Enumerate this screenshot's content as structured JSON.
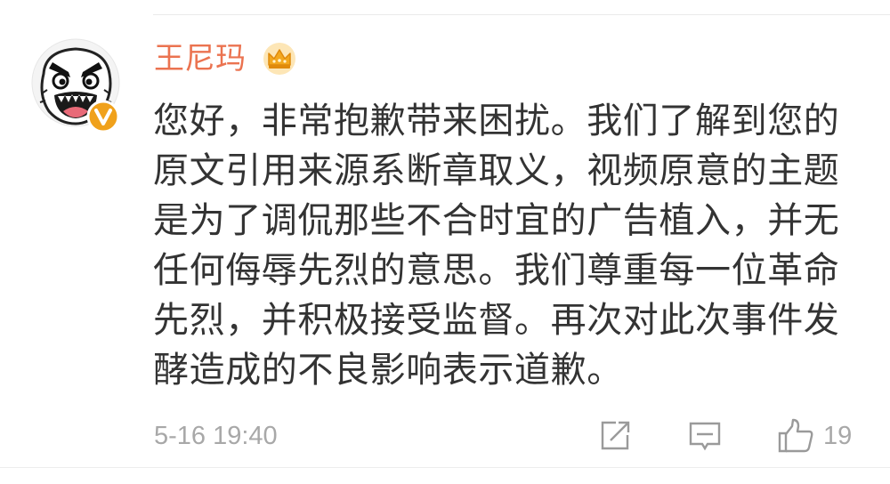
{
  "comment": {
    "username": "王尼玛",
    "username_color": "#eb7350",
    "badges": {
      "member_icon": "crown-icon",
      "verified_icon": "verified-v-icon"
    },
    "avatar_icon": "rage-face-avatar",
    "body_lines": [
      "您好，非常抱歉带来困扰。我们了解到您的",
      "原文引用来源系断章取义，视频原意的主题",
      "是为了调侃那些不合时宜的广告植入，并无",
      "任何侮辱先烈的意思。我们尊重每一位革命",
      "先烈，并积极接受监督。再次对此次事件发",
      "酵造成的不良影响表示道歉。"
    ],
    "timestamp": "5-16 19:40",
    "actions": {
      "share_icon": "share-icon",
      "comment_icon": "comment-icon",
      "like_icon": "thumbs-up-icon",
      "like_count": "19"
    }
  }
}
